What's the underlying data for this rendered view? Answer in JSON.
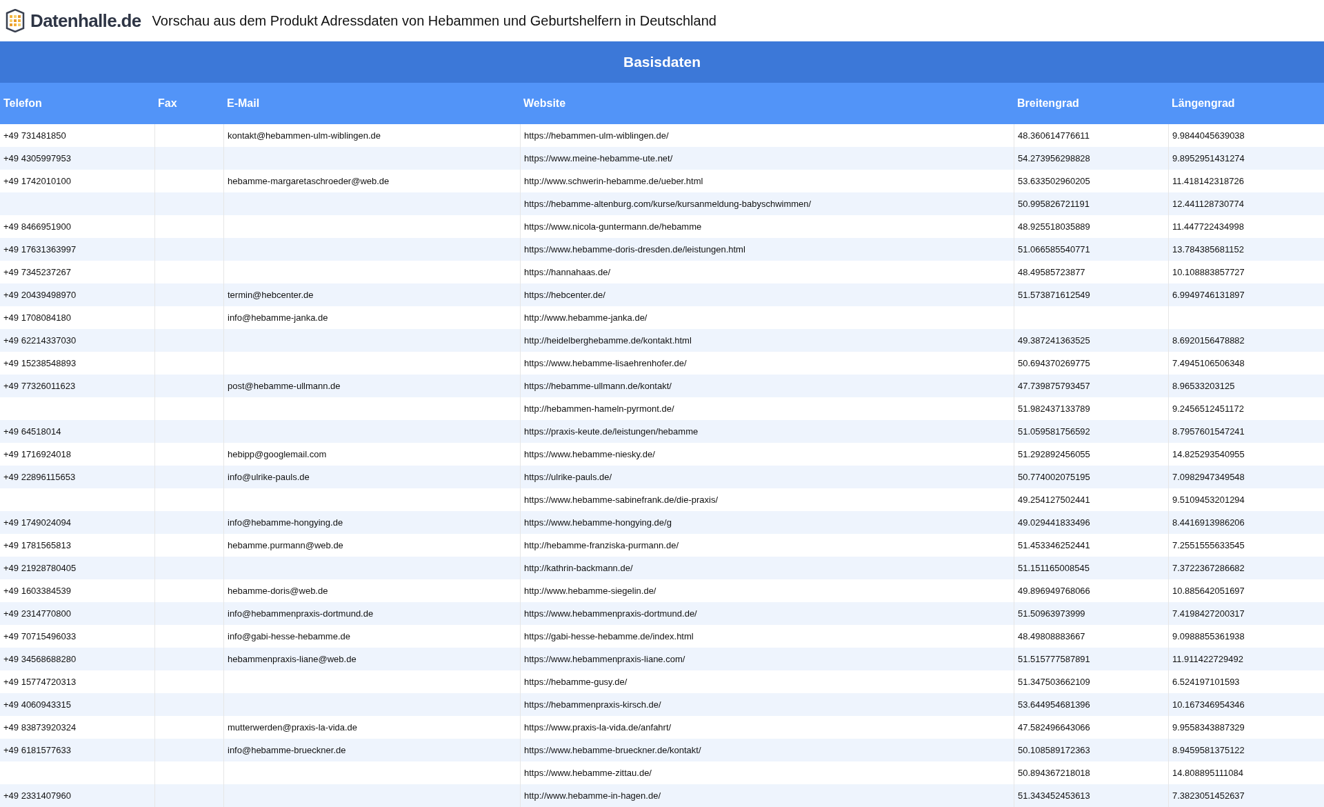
{
  "header": {
    "logo_text": "Datenhalle.de",
    "title": "Vorschau aus dem Produkt Adressdaten von Hebammen und Geburtshelfern in Deutschland"
  },
  "section_title": "Basisdaten",
  "table": {
    "columns": [
      "Telefon",
      "Fax",
      "E-Mail",
      "Website",
      "Breitengrad",
      "Längengrad"
    ],
    "rows": [
      {
        "telefon": "+49 731481850",
        "email": "kontakt@hebammen-ulm-wiblingen.de",
        "website": "https://hebammen-ulm-wiblingen.de/",
        "lat": "48.360614776611",
        "lon": "9.9844045639038"
      },
      {
        "telefon": "+49 4305997953",
        "website": "https://www.meine-hebamme-ute.net/",
        "lat": "54.273956298828",
        "lon": "9.8952951431274"
      },
      {
        "telefon": "+49 1742010100",
        "email": "hebamme-margaretaschroeder@web.de",
        "website": "http://www.schwerin-hebamme.de/ueber.html",
        "lat": "53.633502960205",
        "lon": "11.418142318726"
      },
      {
        "website": "https://hebamme-altenburg.com/kurse/kursanmeldung-babyschwimmen/",
        "lat": "50.995826721191",
        "lon": "12.441128730774"
      },
      {
        "telefon": "+49 8466951900",
        "website": "https://www.nicola-guntermann.de/hebamme",
        "lat": "48.925518035889",
        "lon": "11.447722434998"
      },
      {
        "telefon": "+49 17631363997",
        "website": "https://www.hebamme-doris-dresden.de/leistungen.html",
        "lat": "51.066585540771",
        "lon": "13.784385681152"
      },
      {
        "telefon": "+49 7345237267",
        "website": "https://hannahaas.de/",
        "lat": "48.49585723877",
        "lon": "10.108883857727"
      },
      {
        "telefon": "+49 20439498970",
        "email": "termin@hebcenter.de",
        "website": "https://hebcenter.de/",
        "lat": "51.573871612549",
        "lon": "6.9949746131897"
      },
      {
        "telefon": "+49 1708084180",
        "email": "info@hebamme-janka.de",
        "website": "http://www.hebamme-janka.de/"
      },
      {
        "telefon": "+49 62214337030",
        "website": "http://heidelberghebamme.de/kontakt.html",
        "lat": "49.387241363525",
        "lon": "8.6920156478882"
      },
      {
        "telefon": "+49 15238548893",
        "website": "https://www.hebamme-lisaehrenhofer.de/",
        "lat": "50.694370269775",
        "lon": "7.4945106506348"
      },
      {
        "telefon": "+49 77326011623",
        "email": "post@hebamme-ullmann.de",
        "website": "https://hebamme-ullmann.de/kontakt/",
        "lat": "47.739875793457",
        "lon": "8.96533203125"
      },
      {
        "website": "http://hebammen-hameln-pyrmont.de/",
        "lat": "51.982437133789",
        "lon": "9.2456512451172"
      },
      {
        "telefon": "+49 64518014",
        "website": "https://praxis-keute.de/leistungen/hebamme",
        "lat": "51.059581756592",
        "lon": "8.7957601547241"
      },
      {
        "telefon": "+49 1716924018",
        "email": "hebipp@googlemail.com",
        "website": "https://www.hebamme-niesky.de/",
        "lat": "51.292892456055",
        "lon": "14.825293540955"
      },
      {
        "telefon": "+49 22896115653",
        "email": "info@ulrike-pauls.de",
        "website": "https://ulrike-pauls.de/",
        "lat": "50.774002075195",
        "lon": "7.0982947349548"
      },
      {
        "website": "https://www.hebamme-sabinefrank.de/die-praxis/",
        "lat": "49.254127502441",
        "lon": "9.5109453201294"
      },
      {
        "telefon": "+49 1749024094",
        "email": "info@hebamme-hongying.de",
        "website": "https://www.hebamme-hongying.de/g",
        "lat": "49.029441833496",
        "lon": "8.4416913986206"
      },
      {
        "telefon": "+49 1781565813",
        "email": "hebamme.purmann@web.de",
        "website": "http://hebamme-franziska-purmann.de/",
        "lat": "51.453346252441",
        "lon": "7.2551555633545"
      },
      {
        "telefon": "+49 21928780405",
        "website": "http://kathrin-backmann.de/",
        "lat": "51.151165008545",
        "lon": "7.3722367286682"
      },
      {
        "telefon": "+49 1603384539",
        "email": "hebamme-doris@web.de",
        "website": "http://www.hebamme-siegelin.de/",
        "lat": "49.896949768066",
        "lon": "10.885642051697"
      },
      {
        "telefon": "+49 2314770800",
        "email": "info@hebammenpraxis-dortmund.de",
        "website": "https://www.hebammenpraxis-dortmund.de/",
        "lat": "51.50963973999",
        "lon": "7.4198427200317"
      },
      {
        "telefon": "+49 70715496033",
        "email": "info@gabi-hesse-hebamme.de",
        "website": "https://gabi-hesse-hebamme.de/index.html",
        "lat": "48.49808883667",
        "lon": "9.0988855361938"
      },
      {
        "telefon": "+49 34568688280",
        "email": "hebammenpraxis-liane@web.de",
        "website": "https://www.hebammenpraxis-liane.com/",
        "lat": "51.515777587891",
        "lon": "11.911422729492"
      },
      {
        "telefon": "+49 15774720313",
        "website": "https://hebamme-gusy.de/",
        "lat": "51.347503662109",
        "lon": "6.524197101593"
      },
      {
        "telefon": "+49 4060943315",
        "website": "https://hebammenpraxis-kirsch.de/",
        "lat": "53.644954681396",
        "lon": "10.167346954346"
      },
      {
        "telefon": "+49 83873920324",
        "email": "mutterwerden@praxis-la-vida.de",
        "website": "https://www.praxis-la-vida.de/anfahrt/",
        "lat": "47.582496643066",
        "lon": "9.9558343887329"
      },
      {
        "telefon": "+49 6181577633",
        "email": "info@hebamme-brueckner.de",
        "website": "https://www.hebamme-brueckner.de/kontakt/",
        "lat": "50.108589172363",
        "lon": "8.9459581375122"
      },
      {
        "website": "https://www.hebamme-zittau.de/",
        "lat": "50.894367218018",
        "lon": "14.808895111084"
      },
      {
        "telefon": "+49 2331407960",
        "website": "http://www.hebamme-in-hagen.de/",
        "lat": "51.343452453613",
        "lon": "7.3823051452637"
      }
    ]
  }
}
